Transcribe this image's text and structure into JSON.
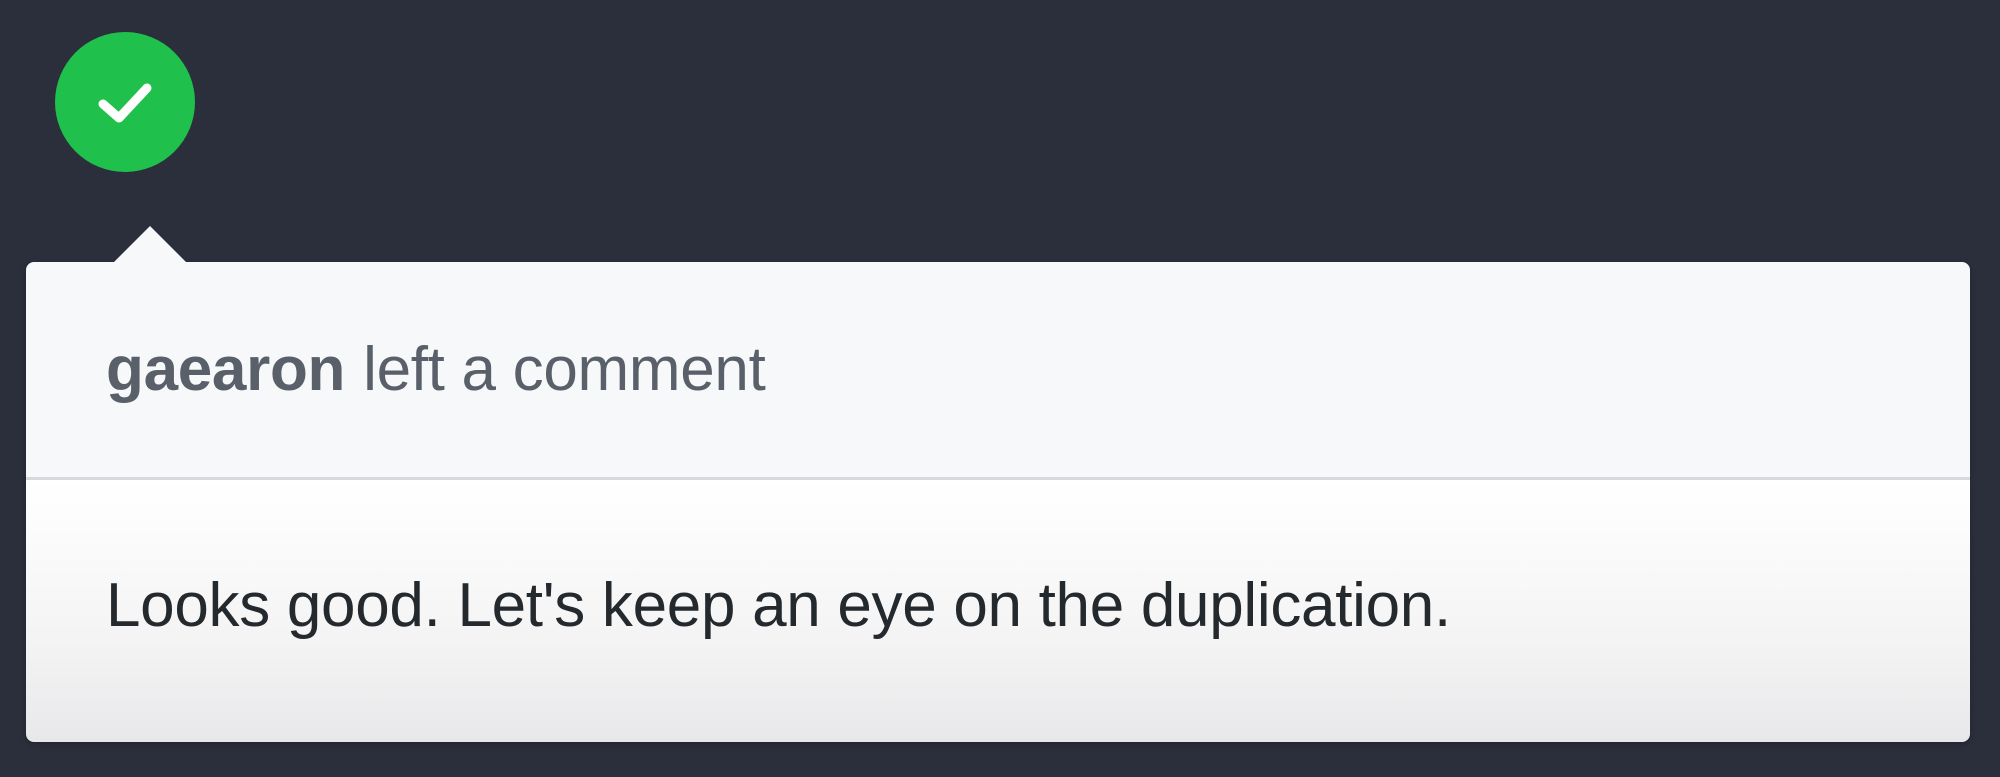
{
  "status": {
    "icon": "check-icon",
    "color": "#1fc04c",
    "label": "approved"
  },
  "comment": {
    "author": "gaearon",
    "action": "left a comment",
    "body": "Looks good. Let's keep an eye on the duplication."
  },
  "colors": {
    "background": "#2b2f3c",
    "header_bg": "#f6f8fa",
    "muted_text": "#596069",
    "body_text": "#24292e"
  }
}
